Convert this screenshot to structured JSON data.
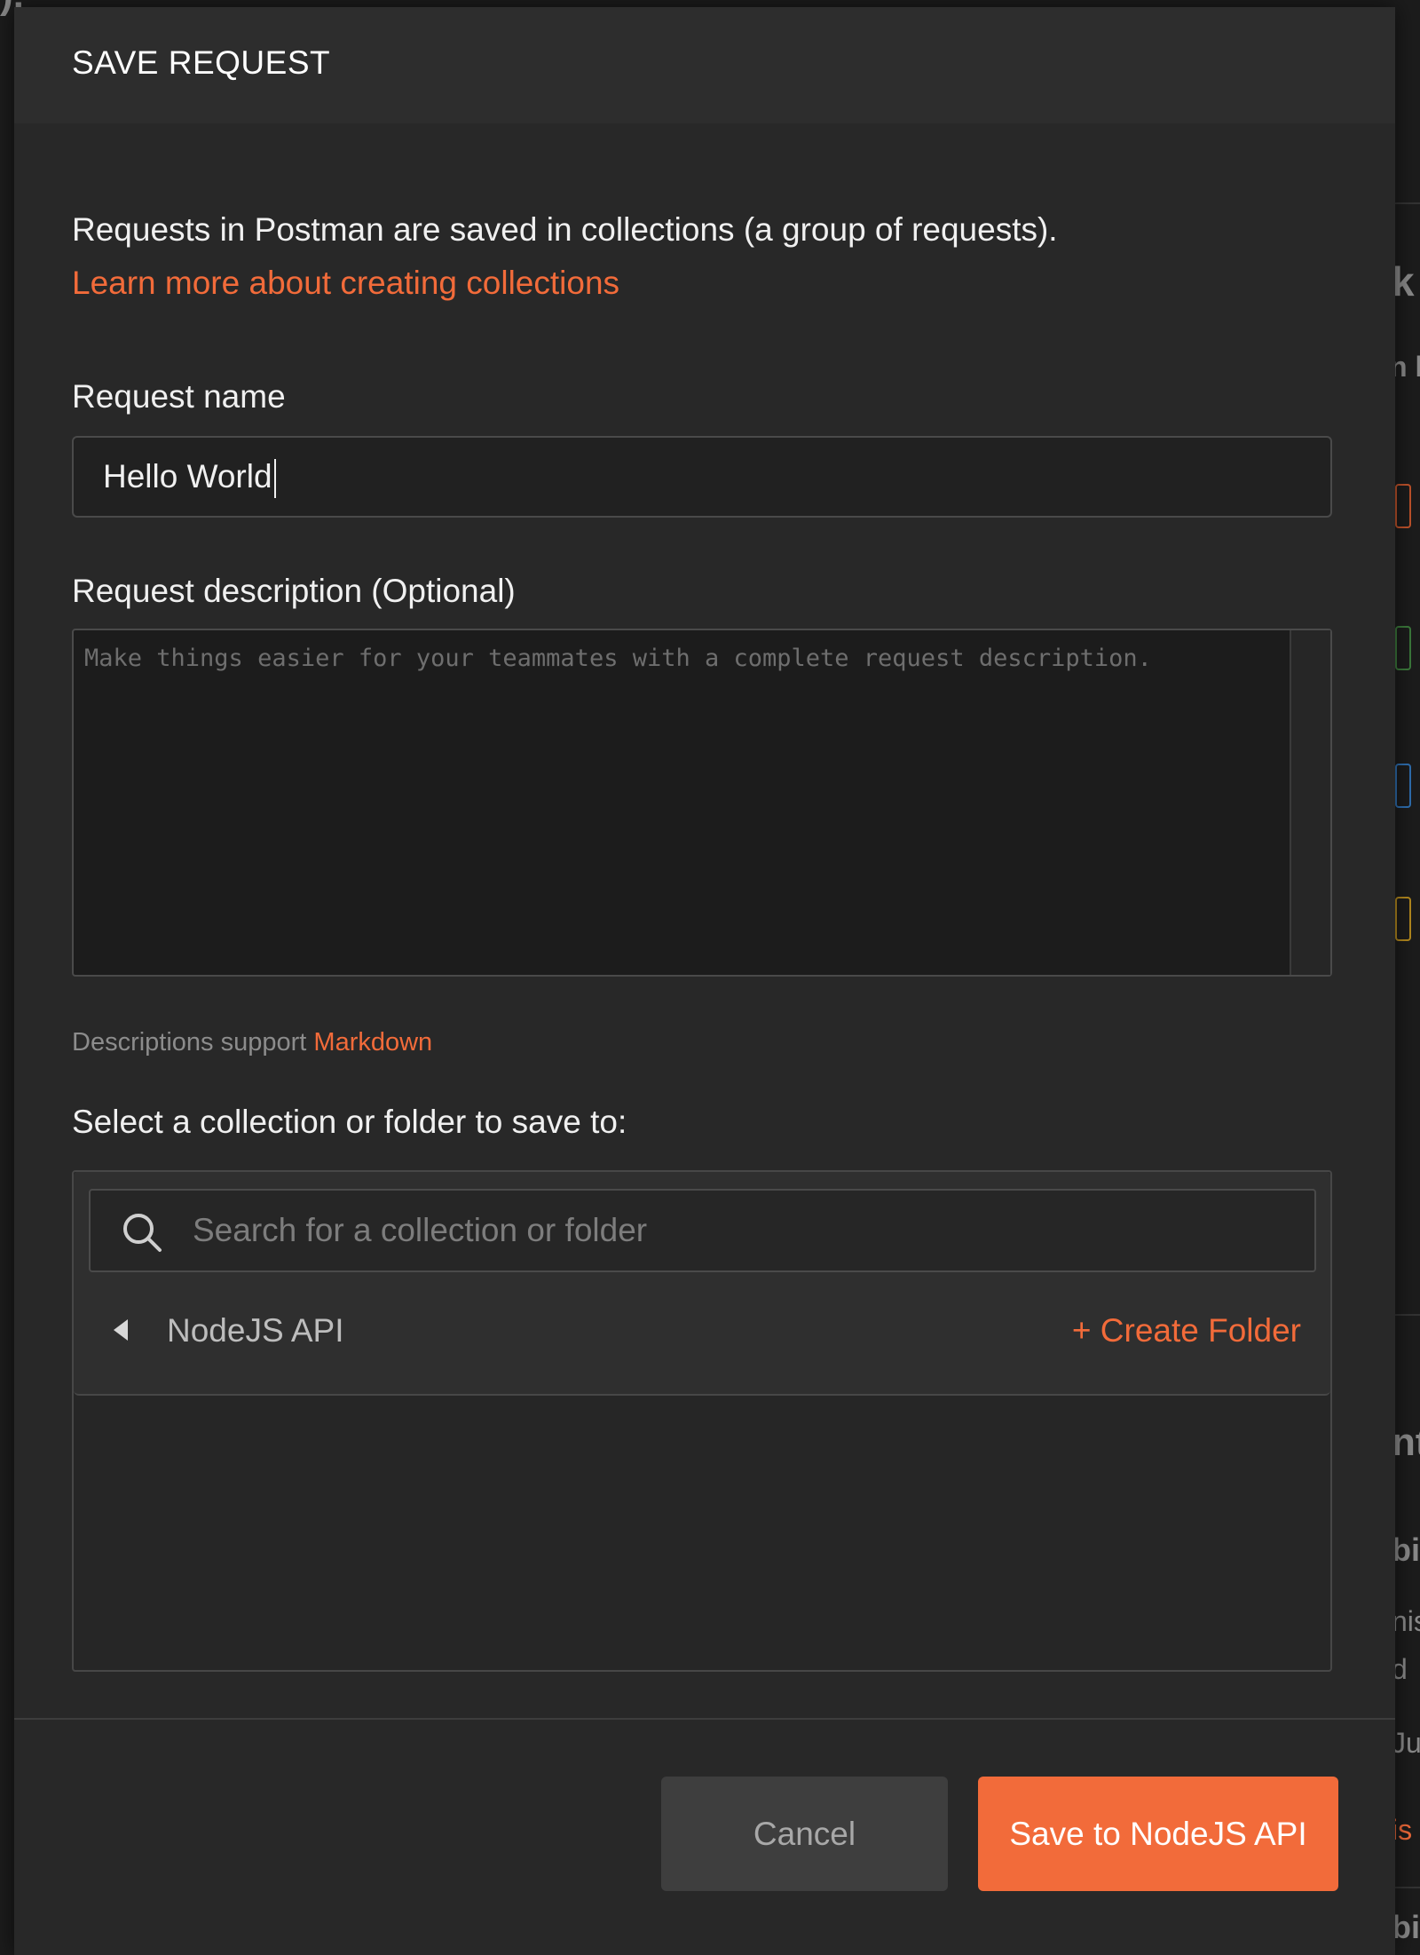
{
  "background": {
    "fragments": [
      "), ",
      "k",
      "n l",
      "nt",
      "bi",
      "nis",
      "d",
      "Ju",
      "is",
      "bi"
    ]
  },
  "colors": {
    "accent": "#f26b3a",
    "modal_bg": "#282828",
    "header_bg": "#2d2d2d",
    "text": "#f0f0f0"
  },
  "modal": {
    "title": "SAVE REQUEST",
    "intro": "Requests in Postman are saved in collections (a group of requests).",
    "learn_link": "Learn more about creating collections",
    "name_label": "Request name",
    "name_value": "Hello World",
    "description_label": "Request description (Optional)",
    "description_placeholder": "Make things easier for your teammates with a complete request description.",
    "markdown_hint": "Descriptions support ",
    "markdown_link": "Markdown",
    "select_label": "Select a collection or folder to save to:",
    "search_placeholder": "Search for a collection or folder",
    "search_icon": "search-icon",
    "collection_name": "NodeJS API",
    "create_folder": "+ Create Folder",
    "cancel_label": "Cancel",
    "save_label": "Save to NodeJS API"
  }
}
